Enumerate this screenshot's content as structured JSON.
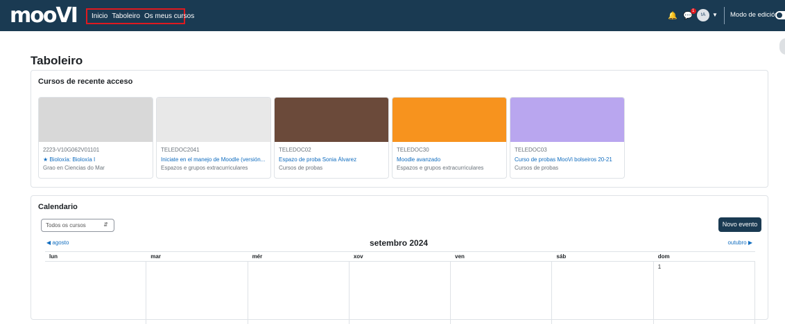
{
  "app": {
    "logo_text": "mooVI"
  },
  "nav": {
    "items": [
      "Inicio",
      "Taboleiro",
      "Os meus cursos"
    ],
    "edit_mode_label": "Modo de edición",
    "avatar_initials": "tA",
    "messages_badge": "1"
  },
  "page": {
    "title": "Taboleiro"
  },
  "recent": {
    "title": "Cursos de recente acceso",
    "courses": [
      {
        "shortname": "2223-V10G062V01101",
        "fullname": "Bioloxía: Bioloxía I",
        "category": "Grao en Ciencias do Mar",
        "starred": true,
        "image_color": "#d8d8d8"
      },
      {
        "shortname": "TELEDOC2041",
        "fullname": "Iniciate en el manejo de Moodle (versión...",
        "category": "Espazos e grupos extracurriculares",
        "starred": false,
        "image_color": "#e8e8e8"
      },
      {
        "shortname": "TELEDOC02",
        "fullname": "Espazo de proba Sonia Álvarez",
        "category": "Cursos de probas",
        "starred": false,
        "image_color": "#6b4a3a"
      },
      {
        "shortname": "TELEDOC30",
        "fullname": "Moodle avanzado",
        "category": "Espazos e grupos extracurriculares",
        "starred": false,
        "image_color": "#f7931e"
      },
      {
        "shortname": "TELEDOC03",
        "fullname": "Curso de probas MooVi bolseiros 20-21",
        "category": "Cursos de probas",
        "starred": false,
        "image_color": "#b9a6ef"
      }
    ]
  },
  "calendar": {
    "title": "Calendario",
    "filter_value": "Todos os cursos",
    "new_event_label": "Novo evento",
    "prev_month": "agosto",
    "next_month": "outubro",
    "month_label": "setembro 2024",
    "weekdays": [
      "lun",
      "mar",
      "mér",
      "xov",
      "ven",
      "sáb",
      "dom"
    ],
    "first_row": [
      "",
      "",
      "",
      "",
      "",
      "",
      "1"
    ]
  }
}
